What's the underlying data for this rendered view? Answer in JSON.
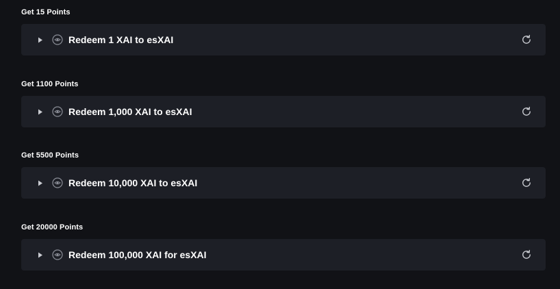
{
  "colors": {
    "page_background": "#111216",
    "card_background": "#1d1f26",
    "text": "#ffffff",
    "icon": "#c9cbd1"
  },
  "sections": [
    {
      "heading": "Get 15 Points",
      "task": {
        "label": "Redeem 1 XAI to esXAI",
        "status_icon": "eye-circle-icon",
        "toggle_icon": "caret-right-icon",
        "action_icon": "refresh-icon"
      }
    },
    {
      "heading": "Get 1100 Points",
      "task": {
        "label": "Redeem 1,000 XAI to esXAI",
        "status_icon": "eye-circle-icon",
        "toggle_icon": "caret-right-icon",
        "action_icon": "refresh-icon"
      }
    },
    {
      "heading": "Get 5500 Points",
      "task": {
        "label": "Redeem 10,000 XAI to esXAI",
        "status_icon": "eye-circle-icon",
        "toggle_icon": "caret-right-icon",
        "action_icon": "refresh-icon"
      }
    },
    {
      "heading": "Get 20000 Points",
      "task": {
        "label": "Redeem 100,000 XAI for esXAI",
        "status_icon": "eye-circle-icon",
        "toggle_icon": "caret-right-icon",
        "action_icon": "refresh-icon"
      }
    }
  ]
}
